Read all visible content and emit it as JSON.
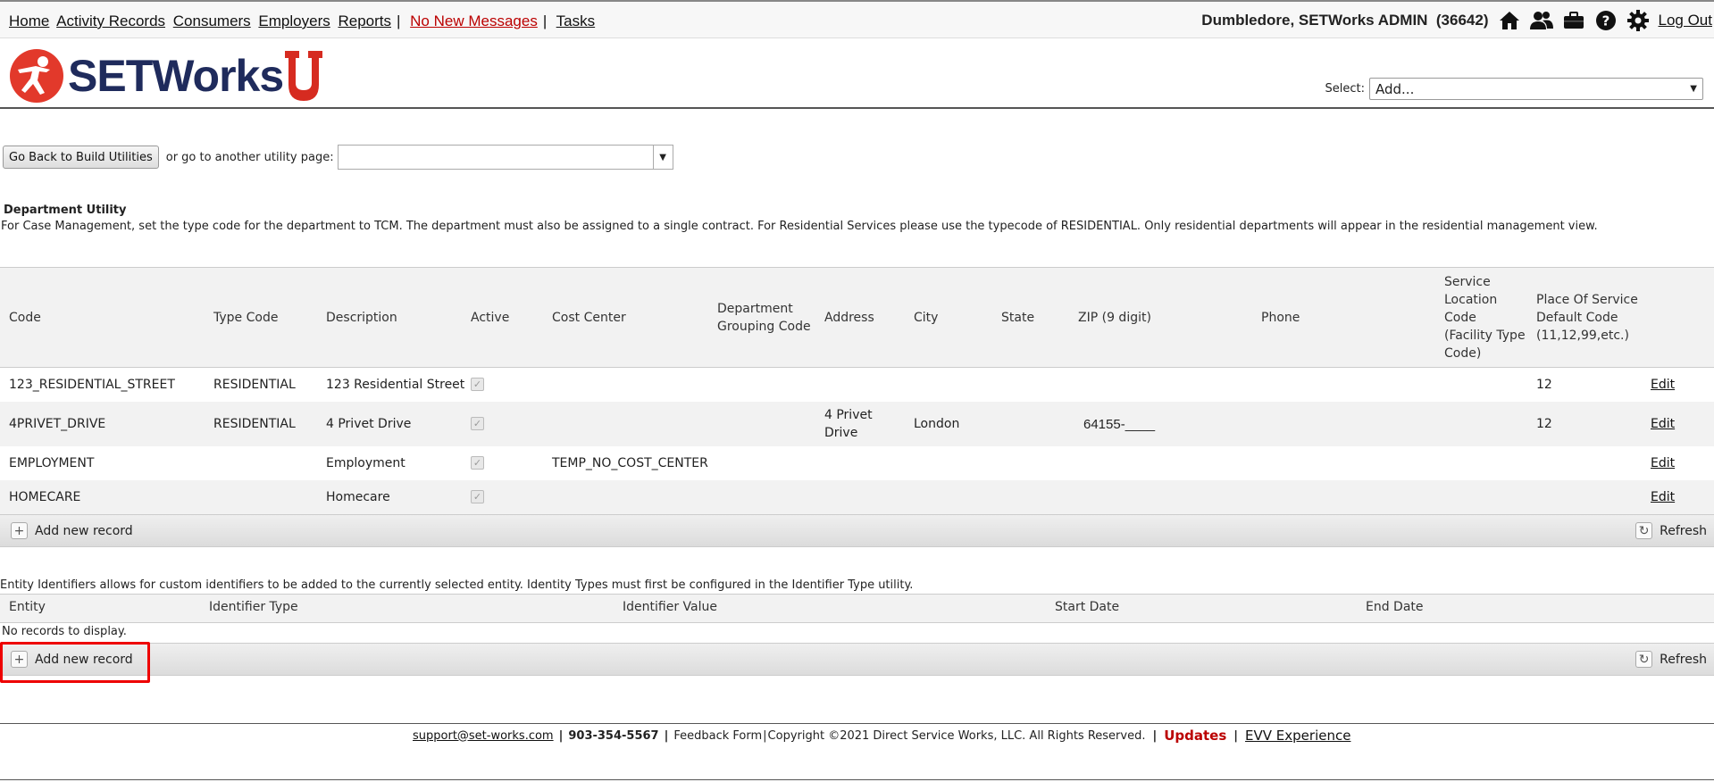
{
  "topnav": {
    "home": "Home",
    "activity_records": "Activity Records",
    "consumers": "Consumers",
    "employers": "Employers",
    "reports": "Reports",
    "messages": "No New Messages",
    "tasks": "Tasks",
    "separator": "|"
  },
  "user": {
    "name": "Dumbledore, SETWorks ADMIN",
    "id": "(36642)",
    "logout": "Log Out",
    "icons": [
      "home-icon",
      "users-icon",
      "briefcase-icon",
      "help-icon",
      "gear-icon"
    ]
  },
  "header": {
    "brand": "SETWorks",
    "select_label": "Select:",
    "select_value": "Add..."
  },
  "utility_nav": {
    "back_button": "Go Back to Build Utilities",
    "or_text": "or go to another utility page:",
    "page_value": ""
  },
  "department": {
    "title": "Department Utility",
    "description": "For Case Management, set the type code for the department to TCM. The department must also be assigned to a single contract. For Residential Services please use the typecode of RESIDENTIAL. Only residential departments will appear in the residential management view.",
    "columns": [
      "Code",
      "Type Code",
      "Description",
      "Active",
      "Cost Center",
      "Department Grouping Code",
      "Address",
      "City",
      "State",
      "ZIP (9 digit)",
      "Phone",
      "Service Location Code (Facility Type Code)",
      "Place Of Service Default Code (11,12,99,etc.)"
    ],
    "rows": [
      {
        "code": "123_RESIDENTIAL_STREET",
        "type": "RESIDENTIAL",
        "desc": "123 Residential Street",
        "cost": "",
        "addr": "",
        "city": "",
        "zip": "",
        "pos": "12",
        "edit": "Edit"
      },
      {
        "code": "4PRIVET_DRIVE",
        "type": "RESIDENTIAL",
        "desc": "4 Privet Drive",
        "cost": "",
        "addr": "4 Privet Drive",
        "city": "London",
        "zip": "64155-____",
        "pos": "12",
        "edit": "Edit"
      },
      {
        "code": "EMPLOYMENT",
        "type": "",
        "desc": "Employment",
        "cost": "TEMP_NO_COST_CENTER",
        "addr": "",
        "city": "",
        "zip": "",
        "pos": "",
        "edit": "Edit"
      },
      {
        "code": "HOMECARE",
        "type": "",
        "desc": "Homecare",
        "cost": "",
        "addr": "",
        "city": "",
        "zip": "",
        "pos": "",
        "edit": "Edit"
      }
    ],
    "add_label": "Add new record",
    "refresh_label": "Refresh"
  },
  "entity": {
    "description": "Entity Identifiers allows for custom identifiers to be added to the currently selected entity. Identity Types must first be configured in the Identifier Type utility.",
    "columns": [
      "Entity",
      "Identifier Type",
      "Identifier Value",
      "Start Date",
      "End Date"
    ],
    "empty": "No records to display.",
    "add_label": "Add new record",
    "refresh_label": "Refresh"
  },
  "footer": {
    "email": "support@set-works.com",
    "phone": "903-354-5567",
    "feedback": "Feedback Form",
    "copyright": "Copyright ©2021 Direct Service Works, LLC. All Rights Reserved.",
    "updates": "Updates",
    "evv": "EVV Experience"
  }
}
